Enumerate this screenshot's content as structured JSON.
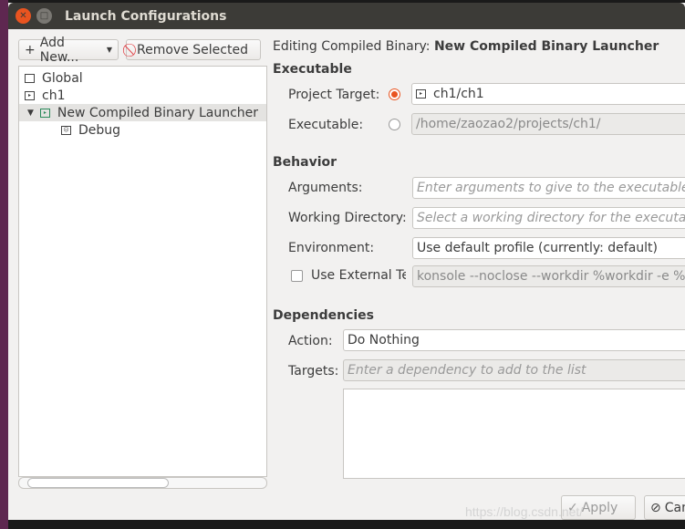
{
  "window": {
    "title": "Launch Configurations"
  },
  "toolbar": {
    "add_new": "Add New...",
    "remove_selected": "Remove Selected"
  },
  "tree": {
    "items": [
      {
        "label": "Global"
      },
      {
        "label": "ch1"
      },
      {
        "label": "New Compiled Binary Launcher",
        "selected": true
      },
      {
        "label": "Debug"
      }
    ]
  },
  "editor": {
    "heading_prefix": "Editing Compiled Binary: ",
    "heading_name": "New Compiled Binary Launcher",
    "executable": {
      "title": "Executable",
      "project_target_label": "Project Target:",
      "project_target_value": "ch1/ch1",
      "executable_label": "Executable:",
      "executable_value": "/home/zaozao2/projects/ch1/",
      "selected": "project_target"
    },
    "behavior": {
      "title": "Behavior",
      "arguments_label": "Arguments:",
      "arguments_placeholder": "Enter arguments to give to the executable",
      "workdir_label": "Working Directory:",
      "workdir_placeholder": "Select a working directory for the executable",
      "environment_label": "Environment:",
      "environment_value": "Use default profile (currently: default)",
      "external_terminal_label": "Use External Te",
      "external_terminal_checked": false,
      "external_terminal_value": "konsole --noclose --workdir %workdir -e %exe"
    },
    "dependencies": {
      "title": "Dependencies",
      "action_label": "Action:",
      "action_value": "Do Nothing",
      "targets_label": "Targets:",
      "targets_placeholder": "Enter a dependency to add to the list"
    }
  },
  "footer": {
    "apply": "Apply",
    "cancel": "Cancel"
  },
  "watermark": "https://blog.csdn.net/"
}
